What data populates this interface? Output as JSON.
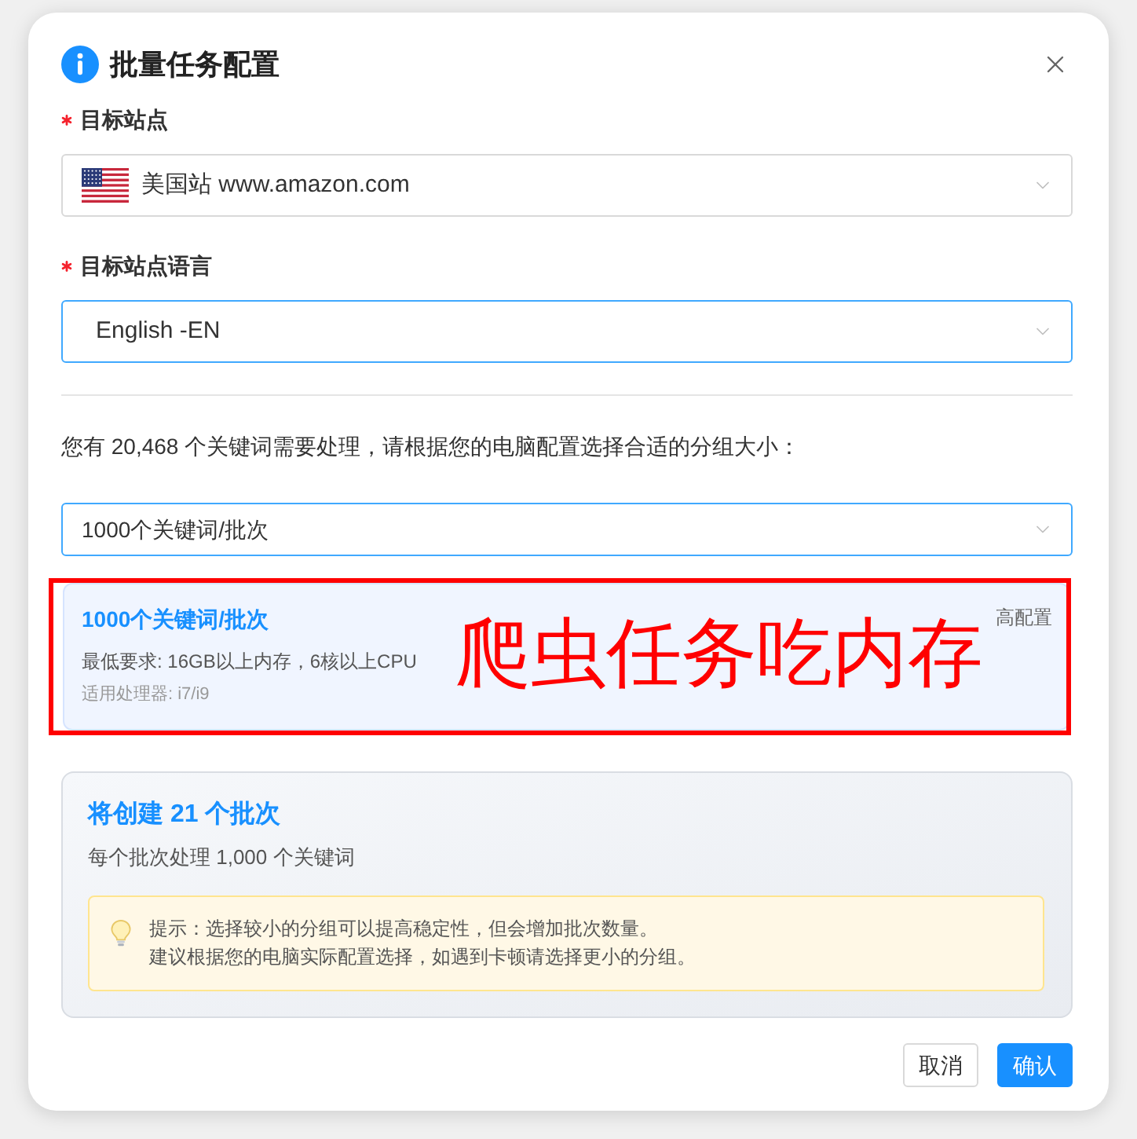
{
  "dialog": {
    "title": "批量任务配置"
  },
  "fields": [
    {
      "label": "目标站点",
      "required": true,
      "kind": "flag_select",
      "value": "美国站 www.amazon.com",
      "focused": false
    },
    {
      "label": "目标站点语言",
      "required": true,
      "kind": "select",
      "value": "English -EN",
      "focused": true
    }
  ],
  "prompt": "您有 20,468 个关键词需要处理，请根据您的电脑配置选择合适的分组大小：",
  "group_select": {
    "value": "1000个关键词/批次",
    "focused": true
  },
  "option_card": {
    "title": "1000个关键词/批次",
    "tag": "高配置",
    "requirement": "最低要求: 16GB以上内存，6核以上CPU",
    "processors": "适用处理器: i7/i9",
    "selected": true
  },
  "annotation": {
    "text": "爬虫任务吃内存"
  },
  "summary": {
    "title": "将创建 21 个批次",
    "subtitle": "每个批次处理 1,000 个关键词",
    "tip_lines": [
      "提示：选择较小的分组可以提高稳定性，但会增加批次数量。",
      "建议根据您的电脑实际配置选择，如遇到卡顿请选择更小的分组。"
    ]
  },
  "buttons": [
    {
      "label": "取消",
      "kind": "default"
    },
    {
      "label": "确认",
      "kind": "primary"
    }
  ]
}
